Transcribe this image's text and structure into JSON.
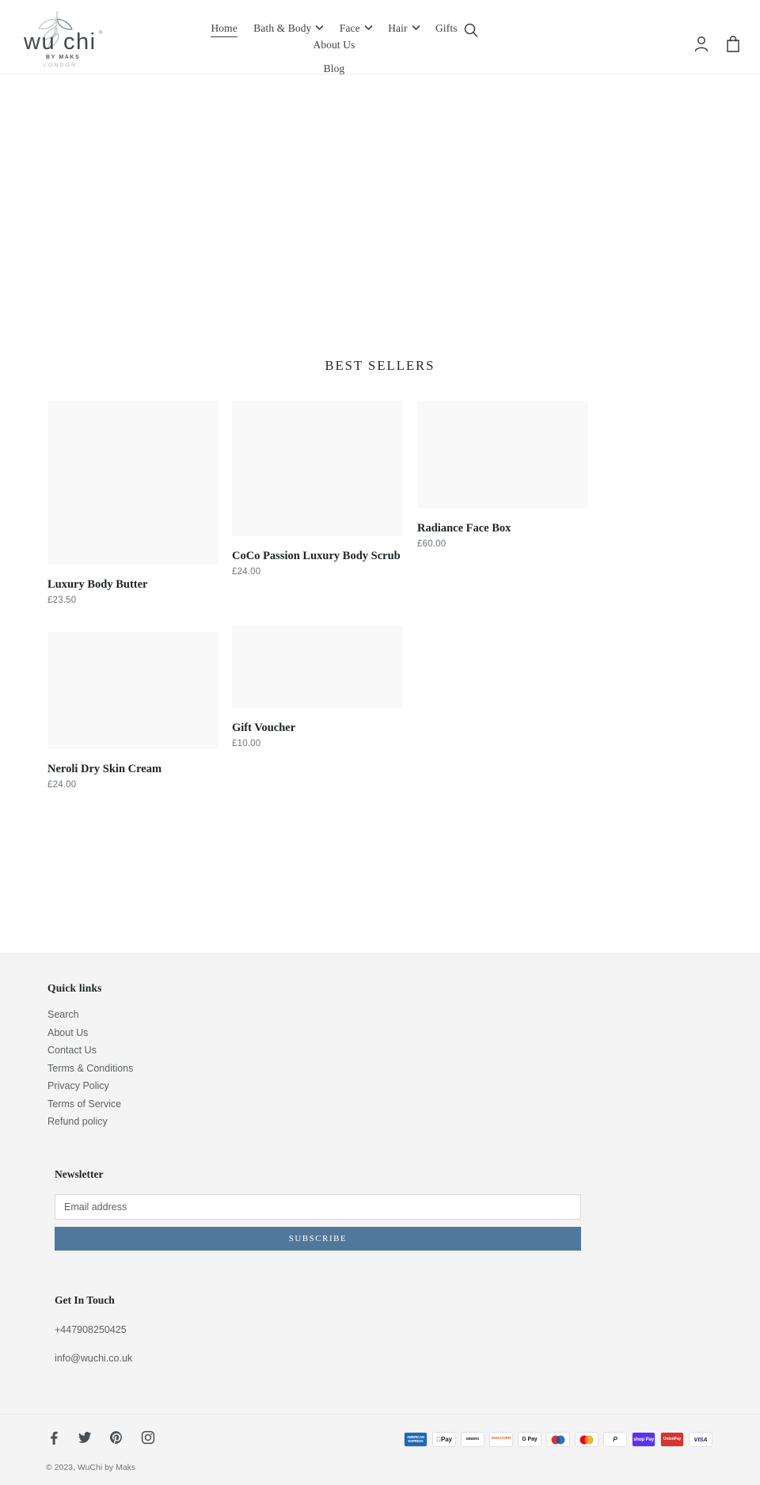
{
  "header": {
    "logo": {
      "name": "wuchi",
      "tagline1": "BY MAKS",
      "tagline2": "LONDON",
      "trademark": "®"
    },
    "nav": [
      {
        "label": "Home",
        "active": true,
        "dropdown": false
      },
      {
        "label": "Bath & Body",
        "active": false,
        "dropdown": true
      },
      {
        "label": "Face",
        "active": false,
        "dropdown": true
      },
      {
        "label": "Hair",
        "active": false,
        "dropdown": true
      },
      {
        "label": "Gifts",
        "active": false,
        "dropdown": false
      },
      {
        "label": "About Us",
        "active": false,
        "dropdown": false
      },
      {
        "label": "Blog",
        "active": false,
        "dropdown": false
      }
    ],
    "search_icon": "search-icon",
    "account_icon": "account-icon",
    "cart_icon": "cart-icon"
  },
  "main": {
    "section_title": "BEST SELLERS",
    "products": [
      {
        "title": "Luxury Body Butter",
        "price": "£23.50"
      },
      {
        "title": "CoCo Passion Luxury Body Scrub",
        "price": "£24.00"
      },
      {
        "title": "Radiance Face Box",
        "price": "£60.00"
      },
      {
        "title": "Neroli Dry Skin Cream",
        "price": "£24.00"
      },
      {
        "title": "Gift Voucher",
        "price": "£10.00"
      }
    ]
  },
  "footer": {
    "quick_links_title": "Quick links",
    "quick_links": [
      "Search",
      "About Us",
      "Contact Us",
      "Terms & Conditions",
      "Privacy Policy",
      "Terms of Service",
      "Refund policy"
    ],
    "newsletter": {
      "title": "Newsletter",
      "placeholder": "Email address",
      "button": "SUBSCRIBE",
      "button_color": "#50789b"
    },
    "get_in_touch": {
      "title": "Get In Touch",
      "phone": "+447908250425",
      "email": "info@wuchi.co.uk"
    },
    "socials": [
      "facebook-icon",
      "twitter-icon",
      "pinterest-icon",
      "instagram-icon"
    ],
    "payments": [
      {
        "name": "american-express",
        "label": "AMERICAN EXPRESS"
      },
      {
        "name": "apple-pay",
        "label": "Pay"
      },
      {
        "name": "diners-club",
        "label": "DINERS"
      },
      {
        "name": "discover",
        "label": "DISCOVER"
      },
      {
        "name": "google-pay",
        "label": "G Pay"
      },
      {
        "name": "maestro",
        "label": "maestro"
      },
      {
        "name": "mastercard",
        "label": ""
      },
      {
        "name": "paypal",
        "label": "P"
      },
      {
        "name": "shop-pay",
        "label": "shop Pay"
      },
      {
        "name": "union-pay",
        "label": "UnionPay"
      },
      {
        "name": "visa",
        "label": "VISA"
      }
    ],
    "copyright": "© 2023, WuChi by Maks"
  }
}
